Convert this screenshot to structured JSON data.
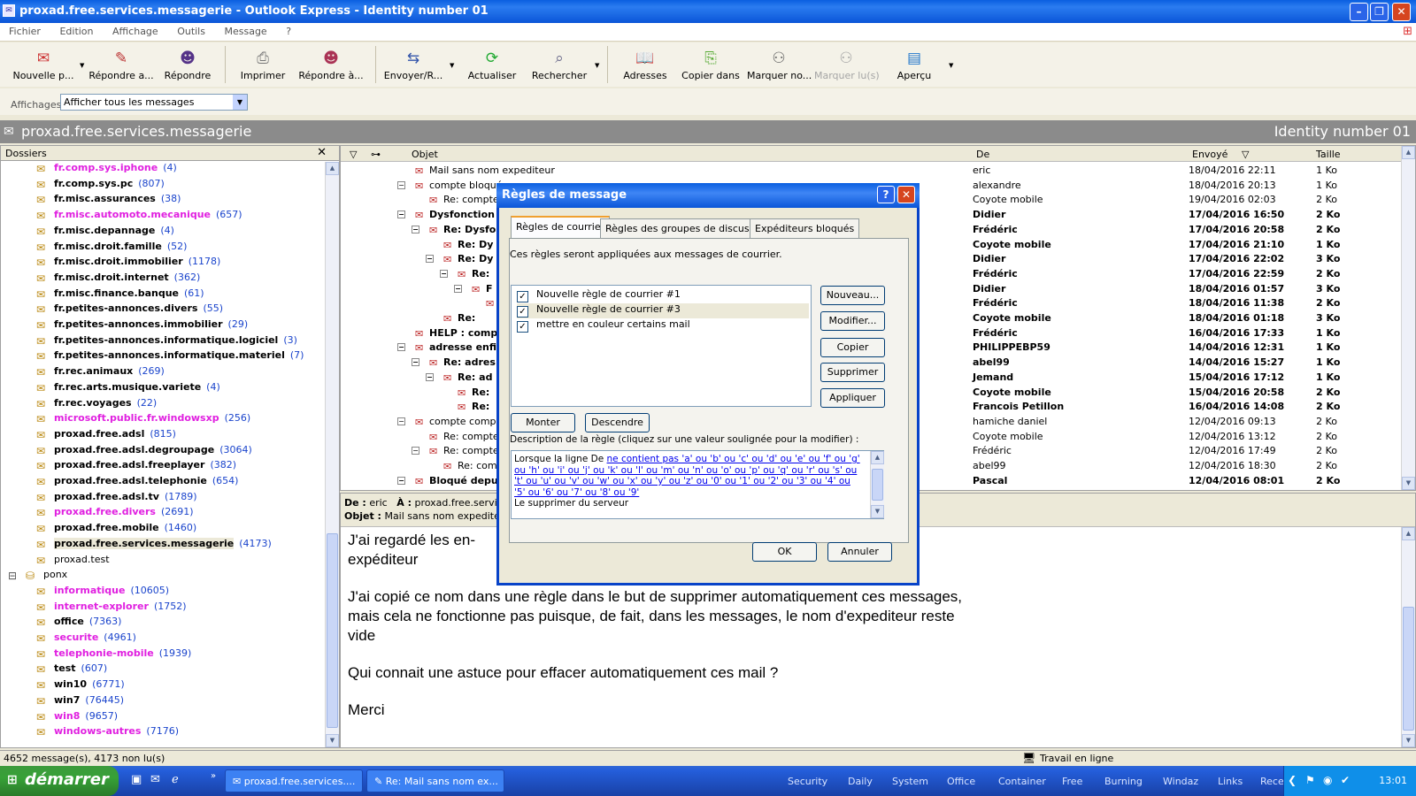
{
  "window": {
    "title": "proxad.free.services.messagerie - Outlook Express - Identity number 01"
  },
  "menu": [
    "Fichier",
    "Edition",
    "Affichage",
    "Outils",
    "Message",
    "?"
  ],
  "toolbar": [
    {
      "label": "Nouvelle p...",
      "icon": "new-message-icon"
    },
    {
      "label": "Répondre a...",
      "icon": "reply-group-icon"
    },
    {
      "label": "Répondre",
      "icon": "reply-icon"
    },
    {
      "label": "Imprimer",
      "icon": "printer-icon"
    },
    {
      "label": "Répondre à...",
      "icon": "reply-all-icon"
    },
    {
      "label": "Envoyer/R...",
      "icon": "send-receive-icon"
    },
    {
      "label": "Actualiser",
      "icon": "refresh-icon"
    },
    {
      "label": "Rechercher",
      "icon": "find-icon"
    },
    {
      "label": "Adresses",
      "icon": "address-book-icon"
    },
    {
      "label": "Copier dans",
      "icon": "copy-to-icon"
    },
    {
      "label": "Marquer no...",
      "icon": "mark-unread-icon"
    },
    {
      "label": "Marquer lu(s)",
      "icon": "mark-read-icon"
    },
    {
      "label": "Aperçu",
      "icon": "preview-icon"
    }
  ],
  "views": {
    "label": "Affichages",
    "selected": "Afficher tous les messages"
  },
  "banner": {
    "folder": "proxad.free.services.messagerie",
    "identity": "Identity number 01"
  },
  "folders": {
    "header": "Dossiers",
    "items": [
      {
        "name": "fr.comp.sys.iphone",
        "count": "(4)",
        "style": "mag"
      },
      {
        "name": "fr.comp.sys.pc",
        "count": "(807)",
        "style": ""
      },
      {
        "name": "fr.misc.assurances",
        "count": "(38)",
        "style": ""
      },
      {
        "name": "fr.misc.automoto.mecanique",
        "count": "(657)",
        "style": "mag"
      },
      {
        "name": "fr.misc.depannage",
        "count": "(4)",
        "style": ""
      },
      {
        "name": "fr.misc.droit.famille",
        "count": "(52)",
        "style": ""
      },
      {
        "name": "fr.misc.droit.immobilier",
        "count": "(1178)",
        "style": ""
      },
      {
        "name": "fr.misc.droit.internet",
        "count": "(362)",
        "style": ""
      },
      {
        "name": "fr.misc.finance.banque",
        "count": "(61)",
        "style": ""
      },
      {
        "name": "fr.petites-annonces.divers",
        "count": "(55)",
        "style": ""
      },
      {
        "name": "fr.petites-annonces.immobilier",
        "count": "(29)",
        "style": ""
      },
      {
        "name": "fr.petites-annonces.informatique.logiciel",
        "count": "(3)",
        "style": ""
      },
      {
        "name": "fr.petites-annonces.informatique.materiel",
        "count": "(7)",
        "style": ""
      },
      {
        "name": "fr.rec.animaux",
        "count": "(269)",
        "style": ""
      },
      {
        "name": "fr.rec.arts.musique.variete",
        "count": "(4)",
        "style": ""
      },
      {
        "name": "fr.rec.voyages",
        "count": "(22)",
        "style": ""
      },
      {
        "name": "microsoft.public.fr.windowsxp",
        "count": "(256)",
        "style": "mag"
      },
      {
        "name": "proxad.free.adsl",
        "count": "(815)",
        "style": ""
      },
      {
        "name": "proxad.free.adsl.degroupage",
        "count": "(3064)",
        "style": ""
      },
      {
        "name": "proxad.free.adsl.freeplayer",
        "count": "(382)",
        "style": ""
      },
      {
        "name": "proxad.free.adsl.telephonie",
        "count": "(654)",
        "style": ""
      },
      {
        "name": "proxad.free.adsl.tv",
        "count": "(1789)",
        "style": ""
      },
      {
        "name": "proxad.free.divers",
        "count": "(2691)",
        "style": "mag"
      },
      {
        "name": "proxad.free.mobile",
        "count": "(1460)",
        "style": ""
      },
      {
        "name": "proxad.free.services.messagerie",
        "count": "(4173)",
        "style": "sel"
      },
      {
        "name": "proxad.test",
        "count": "",
        "style": "plain"
      },
      {
        "name": "ponx",
        "count": "",
        "style": "server"
      },
      {
        "name": "informatique",
        "count": "(10605)",
        "style": "mag"
      },
      {
        "name": "internet-explorer",
        "count": "(1752)",
        "style": "mag"
      },
      {
        "name": "office",
        "count": "(7363)",
        "style": ""
      },
      {
        "name": "securite",
        "count": "(4961)",
        "style": "mag"
      },
      {
        "name": "telephonie-mobile",
        "count": "(1939)",
        "style": "mag"
      },
      {
        "name": "test",
        "count": "(607)",
        "style": ""
      },
      {
        "name": "win10",
        "count": "(6771)",
        "style": ""
      },
      {
        "name": "win7",
        "count": "(76445)",
        "style": ""
      },
      {
        "name": "win8",
        "count": "(9657)",
        "style": "mag"
      },
      {
        "name": "windows-autres",
        "count": "(7176)",
        "style": "mag"
      }
    ]
  },
  "messages": {
    "headers": {
      "subject": "Objet",
      "from": "De",
      "date": "Envoyé",
      "size": "Taille"
    },
    "rows": [
      {
        "subject": "Mail sans nom expediteur",
        "from": "eric",
        "date": "18/04/2016 22:11",
        "size": "1 Ko",
        "indent": 0,
        "toggle": "",
        "bold": false
      },
      {
        "subject": "compte bloqué",
        "from": "alexandre",
        "date": "18/04/2016 20:13",
        "size": "1 Ko",
        "indent": 0,
        "toggle": "−",
        "bold": false
      },
      {
        "subject": "Re: compte",
        "from": "Coyote mobile",
        "date": "19/04/2016 02:03",
        "size": "2 Ko",
        "indent": 1,
        "toggle": "",
        "bold": false
      },
      {
        "subject": "Dysfonction",
        "from": "Didier",
        "date": "17/04/2016 16:50",
        "size": "2 Ko",
        "indent": 0,
        "toggle": "−",
        "bold": true
      },
      {
        "subject": "Re: Dysfo",
        "from": "Frédéric",
        "date": "17/04/2016 20:58",
        "size": "2 Ko",
        "indent": 1,
        "toggle": "−",
        "bold": true
      },
      {
        "subject": "Re: Dy",
        "from": "Coyote mobile",
        "date": "17/04/2016 21:10",
        "size": "1 Ko",
        "indent": 2,
        "toggle": "",
        "bold": true
      },
      {
        "subject": "Re: Dy",
        "from": "Didier",
        "date": "17/04/2016 22:02",
        "size": "3 Ko",
        "indent": 2,
        "toggle": "−",
        "bold": true
      },
      {
        "subject": "Re:",
        "from": "Frédéric",
        "date": "17/04/2016 22:59",
        "size": "2 Ko",
        "indent": 3,
        "toggle": "−",
        "bold": true
      },
      {
        "subject": "F",
        "from": "Didier",
        "date": "18/04/2016 01:57",
        "size": "3 Ko",
        "indent": 4,
        "toggle": "−",
        "bold": true
      },
      {
        "subject": "",
        "from": "Frédéric",
        "date": "18/04/2016 11:38",
        "size": "2 Ko",
        "indent": 5,
        "toggle": "",
        "bold": true
      },
      {
        "subject": "Re:",
        "from": "Coyote mobile",
        "date": "18/04/2016 01:18",
        "size": "3 Ko",
        "indent": 2,
        "toggle": "",
        "bold": true
      },
      {
        "subject": "HELP : comp",
        "from": "Frédéric",
        "date": "16/04/2016 17:33",
        "size": "1 Ko",
        "indent": 0,
        "toggle": "",
        "bold": true
      },
      {
        "subject": "adresse enfi",
        "from": "PHILIPPEBP59",
        "date": "14/04/2016 12:31",
        "size": "1 Ko",
        "indent": 0,
        "toggle": "−",
        "bold": true
      },
      {
        "subject": "Re: adres",
        "from": "abel99",
        "date": "14/04/2016 15:27",
        "size": "1 Ko",
        "indent": 1,
        "toggle": "−",
        "bold": true
      },
      {
        "subject": "Re: ad",
        "from": "Jemand",
        "date": "15/04/2016 17:12",
        "size": "1 Ko",
        "indent": 2,
        "toggle": "−",
        "bold": true
      },
      {
        "subject": "Re:",
        "from": "Coyote mobile",
        "date": "15/04/2016 20:58",
        "size": "2 Ko",
        "indent": 3,
        "toggle": "",
        "bold": true
      },
      {
        "subject": "Re:",
        "from": "Francois Petillon",
        "date": "16/04/2016 14:08",
        "size": "2 Ko",
        "indent": 3,
        "toggle": "",
        "bold": true
      },
      {
        "subject": "compte compr",
        "from": "hamiche daniel",
        "date": "12/04/2016 09:13",
        "size": "2 Ko",
        "indent": 0,
        "toggle": "−",
        "bold": false
      },
      {
        "subject": "Re: compte",
        "from": "Coyote mobile",
        "date": "12/04/2016 13:12",
        "size": "2 Ko",
        "indent": 1,
        "toggle": "",
        "bold": false
      },
      {
        "subject": "Re: compte",
        "from": "Frédéric",
        "date": "12/04/2016 17:49",
        "size": "2 Ko",
        "indent": 1,
        "toggle": "−",
        "bold": false
      },
      {
        "subject": "Re: com",
        "from": "abel99",
        "date": "12/04/2016 18:30",
        "size": "2 Ko",
        "indent": 2,
        "toggle": "",
        "bold": false
      },
      {
        "subject": "Bloqué depu",
        "from": "Pascal",
        "date": "12/04/2016 08:01",
        "size": "2 Ko",
        "indent": 0,
        "toggle": "−",
        "bold": true
      }
    ]
  },
  "preview": {
    "from_label": "De :",
    "from": "eric",
    "to_label": "À :",
    "to": "proxad.free.service",
    "subject_label": "Objet :",
    "subject": "Mail sans nom expediteur",
    "paragraphs": [
      "J'ai regardé les en-",
      "expéditeur",
      "J'ai copié ce nom dans une règle dans le but de supprimer automatiquement ces messages, mais cela ne fonctionne pas puisque, de fait, dans les messages, le nom d'expediteur reste vide",
      "Qui connait une astuce pour effacer automatiquement ces mail ?",
      "Merci"
    ]
  },
  "status": {
    "left": "4652 message(s), 4173 non lu(s)",
    "right": "Travail en ligne"
  },
  "dialog": {
    "title": "Règles de message",
    "tabs": [
      "Règles de courrier",
      "Règles des groupes de discussion",
      "Expéditeurs bloqués"
    ],
    "intro": "Ces règles seront appliquées aux messages de courrier.",
    "rules": [
      {
        "label": "Nouvelle règle de courrier #1",
        "checked": true
      },
      {
        "label": "Nouvelle règle de courrier #3",
        "checked": true
      },
      {
        "label": "mettre en couleur certains mail",
        "checked": true
      }
    ],
    "buttons": {
      "new": "Nouveau...",
      "modify": "Modifier...",
      "copy": "Copier",
      "delete": "Supprimer",
      "apply": "Appliquer",
      "up": "Monter",
      "down": "Descendre",
      "ok": "OK",
      "cancel": "Annuler"
    },
    "desc_label": "Description de la règle (cliquez sur une valeur soulignée pour la modifier) :",
    "desc_prefix": "Lorsque la ligne De ",
    "desc_link": "ne contient pas 'a' ou 'b' ou 'c' ou 'd' ou 'e' ou 'f' ou 'g' ou 'h' ou 'i' ou 'j' ou 'k' ou 'l' ou 'm' ou 'n' ou 'o' ou 'p' ou 'q' ou 'r' ou 's' ou 't' ou 'u' ou 'v' ou 'w' ou 'x' ou 'y' ou 'z' ou '0' ou '1' ou '2' ou '3' ou '4' ou '5' ou '6' ou '7' ou '8' ou '9'",
    "desc_action": "Le supprimer du serveur"
  },
  "taskbar": {
    "start": "démarrer",
    "tasks": [
      "proxad.free.services....",
      "Re: Mail sans nom ex..."
    ],
    "links": [
      "Security",
      "Daily",
      "System",
      "Office",
      "Container",
      "Free",
      "Burning",
      "Windaz",
      "Links",
      "Recent"
    ],
    "clock": "13:01"
  }
}
